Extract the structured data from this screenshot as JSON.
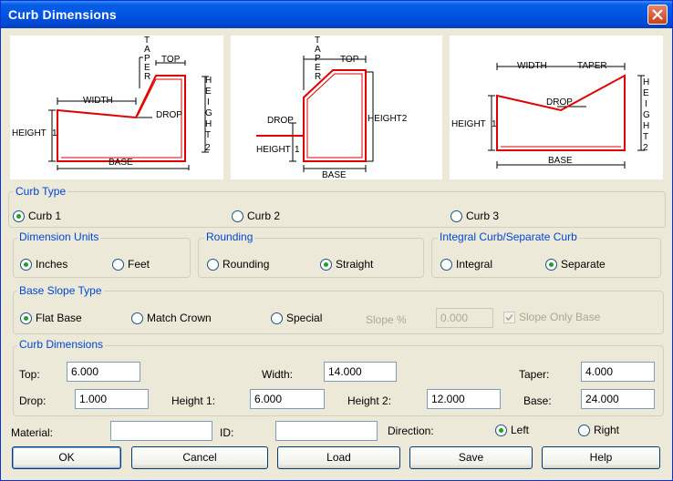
{
  "window": {
    "title": "Curb Dimensions"
  },
  "diagrams": {
    "curb1": {
      "taper": [
        "T",
        "A",
        "P",
        "E",
        "R"
      ],
      "top": "TOP",
      "height_vert": [
        "H",
        "E",
        "I",
        "G",
        "H",
        "T"
      ],
      "width": "WIDTH",
      "drop": "DROP",
      "height": "HEIGHT",
      "one": "1",
      "two": "2",
      "base": "BASE"
    },
    "curb2": {
      "taper": [
        "T",
        "A",
        "P",
        "E",
        "R"
      ],
      "top": "TOP",
      "height2": "HEIGHT2",
      "drop": "DROP",
      "height": "HEIGHT",
      "one": "1",
      "base": "BASE"
    },
    "curb3": {
      "width": "WIDTH",
      "taper": "TAPER",
      "height_vert": [
        "H",
        "E",
        "I",
        "G",
        "H",
        "T"
      ],
      "drop": "DROP",
      "height": "HEIGHT",
      "one": "1",
      "two": "2",
      "base": "BASE"
    }
  },
  "curb_type": {
    "title": "Curb Type",
    "options": [
      "Curb 1",
      "Curb 2",
      "Curb 3"
    ],
    "selected": "Curb 1"
  },
  "dimension_units": {
    "title": "Dimension Units",
    "options": [
      "Inches",
      "Feet"
    ],
    "selected": "Inches"
  },
  "rounding": {
    "title": "Rounding",
    "options": [
      "Rounding",
      "Straight"
    ],
    "selected": "Straight"
  },
  "integral": {
    "title": "Integral Curb/Separate Curb",
    "options": [
      "Integral",
      "Separate"
    ],
    "selected": "Separate"
  },
  "base_slope": {
    "title": "Base Slope Type",
    "options": [
      "Flat Base",
      "Match Crown",
      "Special"
    ],
    "selected": "Flat Base",
    "slope_label": "Slope %",
    "slope_value": "0.000",
    "slope_only_base": "Slope Only Base"
  },
  "dims": {
    "title": "Curb Dimensions",
    "top_label": "Top:",
    "top": "6.000",
    "width_label": "Width:",
    "width": "14.000",
    "taper_label": "Taper:",
    "taper": "4.000",
    "drop_label": "Drop:",
    "drop": "1.000",
    "height1_label": "Height 1:",
    "height1": "6.000",
    "height2_label": "Height 2:",
    "height2": "12.000",
    "base_label": "Base:",
    "base": "24.000"
  },
  "footer": {
    "material_label": "Material:",
    "material": "",
    "id_label": "ID:",
    "id": "",
    "direction_label": "Direction:",
    "direction_options": [
      "Left",
      "Right"
    ],
    "direction_selected": "Left"
  },
  "buttons": {
    "ok": "OK",
    "cancel": "Cancel",
    "load": "Load",
    "save": "Save",
    "help": "Help"
  },
  "colors": {
    "title_bar": "#0055e5",
    "group_label": "#0046d5",
    "curb_outline": "#e00000",
    "radio_selected": "#21a121"
  }
}
